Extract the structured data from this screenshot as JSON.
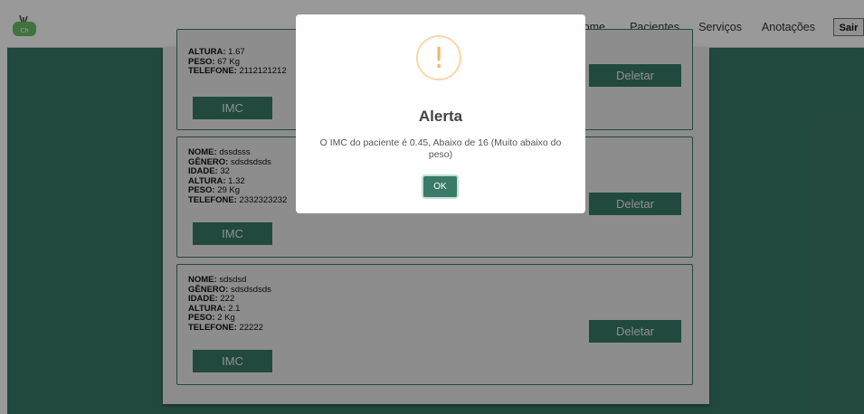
{
  "nav": {
    "links": [
      "ome",
      "Pacientes",
      "Serviços",
      "Anotações"
    ],
    "logout_label": "Sair"
  },
  "labels": {
    "nome": "NOME:",
    "genero": "GÊNERO:",
    "idade": "IDADE:",
    "altura": "ALTURA:",
    "peso": "PESO:",
    "telefone": "TELEFONE:",
    "imc_button": "IMC",
    "delete_button": "Deletar"
  },
  "patients": [
    {
      "altura": "1.67",
      "peso": "67 Kg",
      "telefone": "2112121212"
    },
    {
      "nome": "dssdsss",
      "genero": "sdsdsdsds",
      "idade": "32",
      "altura": "1.32",
      "peso": "29 Kg",
      "telefone": "2332323232"
    },
    {
      "nome": "sdsdsd",
      "genero": "sdsdsdsds",
      "idade": "222",
      "altura": "2.1",
      "peso": "2 Kg",
      "telefone": "22222"
    }
  ],
  "modal": {
    "icon": "!",
    "title": "Alerta",
    "message": "O IMC do paciente é 0.45, Abaixo de 16 (Muito abaixo do peso)",
    "ok_label": "OK"
  },
  "colors": {
    "primary": "#3a7a68",
    "warning": "#f5b764"
  }
}
